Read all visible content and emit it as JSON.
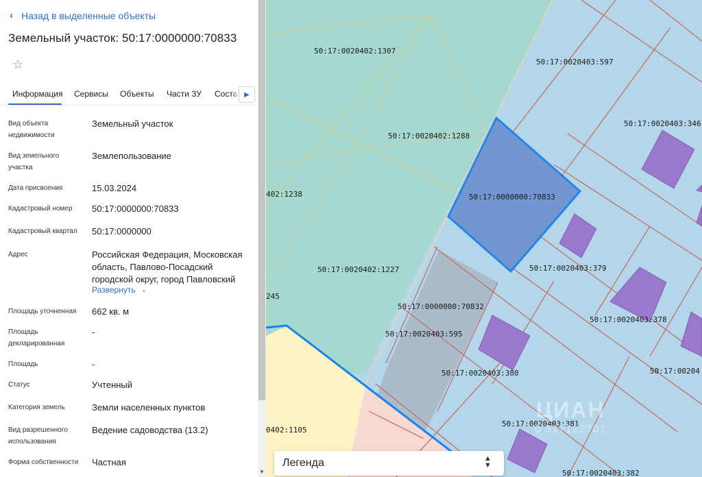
{
  "header": {
    "back_label": "Назад в выделенные объекты",
    "title": "Земельный участок: 50:17:0000000:70833"
  },
  "tabs": [
    {
      "label": "Информация",
      "active": true
    },
    {
      "label": "Сервисы"
    },
    {
      "label": "Объекты"
    },
    {
      "label": "Части ЗУ"
    },
    {
      "label": "Состав"
    }
  ],
  "info": [
    {
      "label": "Вид объекта недвижимости",
      "value": "Земельный участок"
    },
    {
      "label": "Вид земельного участка",
      "value": "Землепользование"
    },
    {
      "label": "Дата присвоения",
      "value": "15.03.2024"
    },
    {
      "label": "Кадастровый номер",
      "value": "50:17:0000000:70833"
    },
    {
      "label": "Кадастровый квартал",
      "value": "50:17:0000000"
    },
    {
      "label": "Адрес",
      "value": "Российская Федерация, Московская область, Павлово-Посадский городской округ, город Павловский"
    },
    {
      "label": "Площадь уточненная",
      "value": "662 кв. м"
    },
    {
      "label": "Площадь декларированная",
      "value": "-"
    },
    {
      "label": "Площадь",
      "value": "-"
    },
    {
      "label": "Статус",
      "value": "Учтенный"
    },
    {
      "label": "Категория земель",
      "value": "Земли населенных пунктов"
    },
    {
      "label": "Вид разрешенного использования",
      "value": "Ведение садоводства (13.2)"
    },
    {
      "label": "Форма собственности",
      "value": "Частная"
    }
  ],
  "expand_label": "Развернуть",
  "map": {
    "labels": [
      "50:17:0020402:1307",
      "50:17:0020403:597",
      "50:17:0020403:346",
      "50:17:0020402:1288",
      "50:17:0000000:70833",
      "402:1238",
      "50:17:0020403:379",
      "50:17:0020402:1227",
      "245",
      "50:17:0000000:70832",
      "50:17:0020403:378",
      "50:17:0020403:595",
      "50:17:0020403:380",
      "50:17:0020403:381",
      "50:17:00204",
      "0402:1105",
      "50:17:0020403:382"
    ],
    "colors": {
      "teal_zone": "#a6d8cf",
      "blue_zone": "#a9d0e8",
      "selected_parcel": "#6e93cf",
      "selected_border": "#1a82e8",
      "building": "#9a78cc",
      "boundary": "#c8685a",
      "yellow_zone": "#fbf3c4",
      "pink_zone": "#f8d8d2"
    }
  },
  "legend": {
    "label": "Легенда"
  },
  "watermark": {
    "brand": "ЦИАН",
    "id": "0 317122701"
  }
}
